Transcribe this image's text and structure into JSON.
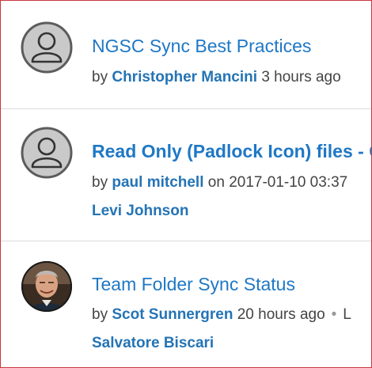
{
  "posts": [
    {
      "title": "NGSC Sync Best Practices",
      "by": "by",
      "author": "Christopher Mancini",
      "time": "3 hours ago",
      "avatar": "default-user-icon"
    },
    {
      "title": "Read Only (Padlock Icon) files - C",
      "by": "by",
      "author": "paul mitchell",
      "on": "on",
      "time": "2017-01-10 03:37",
      "extra_user": "Levi Johnson",
      "avatar": "default-user-icon"
    },
    {
      "title": "Team Folder Sync Status",
      "by": "by",
      "author": "Scot Sunnergren",
      "time": "20 hours ago",
      "separator": "•",
      "trailing": "L",
      "extra_user": "Salvatore Biscari",
      "avatar": "user-photo"
    }
  ],
  "colors": {
    "link": "#1f78c5",
    "meta_text": "#444444",
    "frame_border": "#c8363d"
  }
}
